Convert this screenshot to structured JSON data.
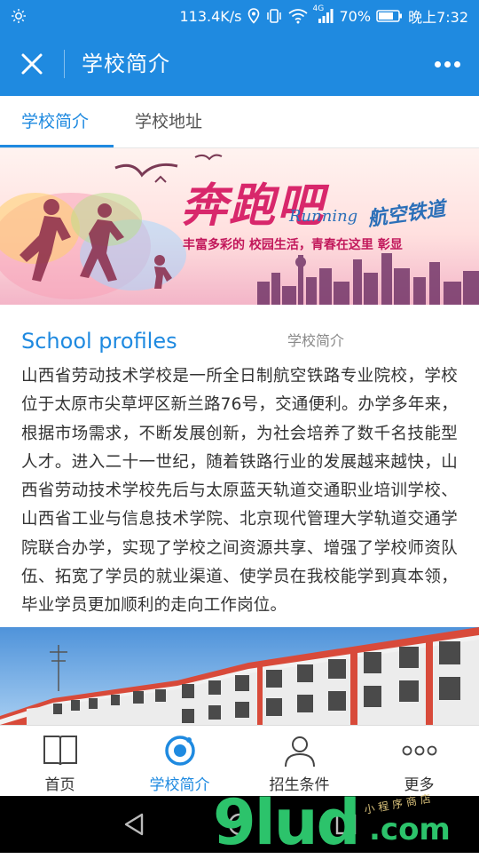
{
  "status_bar": {
    "speed": "113.4K/s",
    "network": "4G",
    "battery": "70%",
    "time": "晚上7:32"
  },
  "nav": {
    "title": "学校简介"
  },
  "tabs": [
    {
      "label": "学校简介",
      "active": true
    },
    {
      "label": "学校地址",
      "active": false
    }
  ],
  "banner": {
    "headline": "奔跑吧",
    "english": "Running",
    "brand": "航空铁道",
    "slogan": "丰富多彩的 校园生活，青春在这里 彰显"
  },
  "section": {
    "title": "School profiles",
    "subtitle": "学校简介"
  },
  "intro_text": "山西省劳动技术学校是一所全日制航空铁路专业院校，学校位于太原市尖草坪区新兰路76号，交通便利。办学多年来，根据市场需求，不断发展创新，为社会培养了数千名技能型人才。进入二十一世纪，随着铁路行业的发展越来越快，山西省劳动技术学校先后与太原蓝天轨道交通职业培训学校、山西省工业与信息技术学院、北京现代管理大学轨道交通学院联合办学，实现了学校之间资源共享、增强了学校师资队伍、拓宽了学员的就业渠道、使学员在我校能学到真本领，毕业学员更加顺利的走向工作岗位。",
  "bottom_tabs": [
    {
      "label": "首页",
      "icon": "book-icon",
      "active": false
    },
    {
      "label": "学校简介",
      "icon": "circle-target-icon",
      "active": true
    },
    {
      "label": "招生条件",
      "icon": "person-icon",
      "active": false
    },
    {
      "label": "更多",
      "icon": "more-dots-icon",
      "active": false
    }
  ],
  "watermark": {
    "main": "9lud",
    "suffix": ".com",
    "small": "小程序商店"
  },
  "colors": {
    "accent": "#1f8ae0",
    "watermark": "#2cc36b"
  }
}
